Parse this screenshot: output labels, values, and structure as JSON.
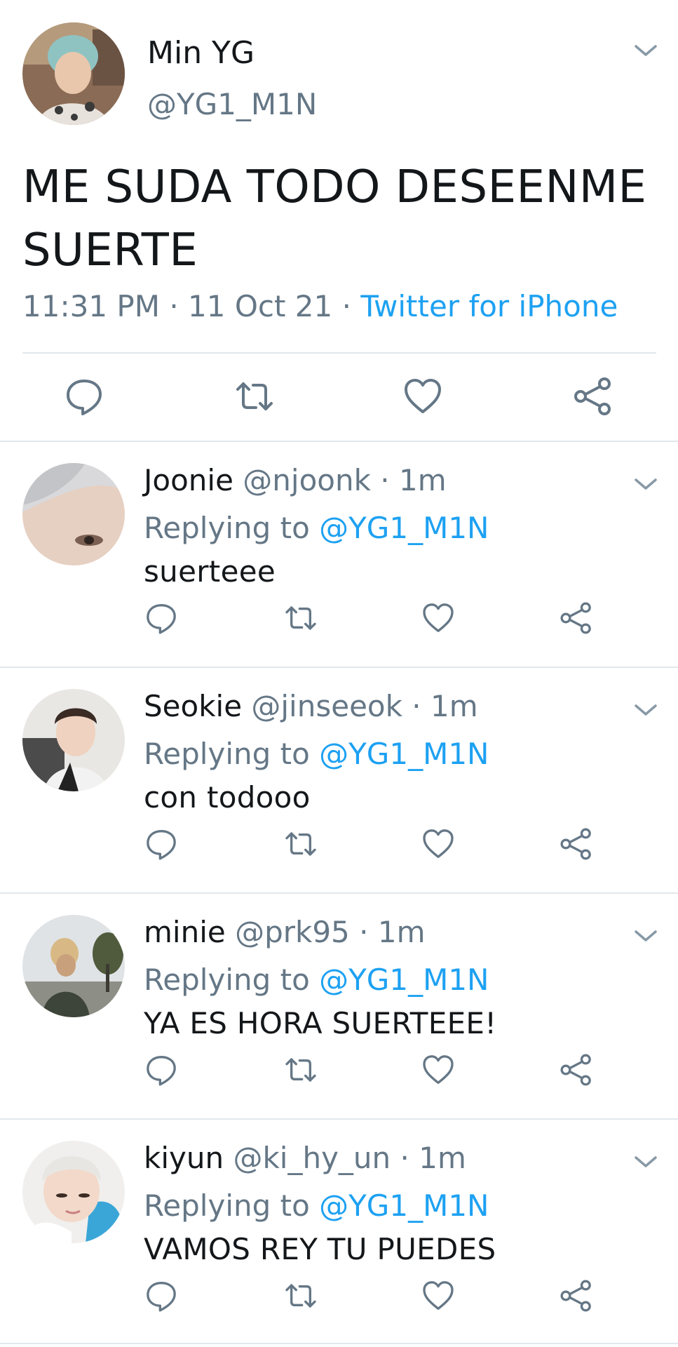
{
  "main": {
    "name": "Min YG",
    "handle": "@YG1_M1N",
    "text": "ME SUDA TODO DESEENME SUERTE",
    "time": "11:31 PM",
    "date": "11 Oct 21",
    "separator": "·",
    "source": "Twitter for iPhone"
  },
  "replies": [
    {
      "name": "Joonie",
      "handle": "@njoonk",
      "time": "1m",
      "replying_prefix": "Replying to",
      "replying_to": "@YG1_M1N",
      "text": "suerteee"
    },
    {
      "name": "Seokie",
      "handle": "@jinseeok",
      "time": "1m",
      "replying_prefix": "Replying to",
      "replying_to": "@YG1_M1N",
      "text": "con todooo"
    },
    {
      "name": "minie",
      "handle": "@prk95",
      "time": "1m",
      "replying_prefix": "Replying to",
      "replying_to": "@YG1_M1N",
      "text": "YA ES HORA SUERTEEE!"
    },
    {
      "name": "kiyun",
      "handle": "@ki_hy_un",
      "time": "1m",
      "replying_prefix": "Replying to",
      "replying_to": "@YG1_M1N",
      "text": "VAMOS REY TU PUEDES"
    }
  ],
  "colors": {
    "text": "#14171a",
    "secondary": "#657786",
    "link": "#1da1f2",
    "divider": "#e1e8ed"
  },
  "icons": [
    "reply-icon",
    "retweet-icon",
    "like-icon",
    "share-icon",
    "chevron-down-icon"
  ]
}
